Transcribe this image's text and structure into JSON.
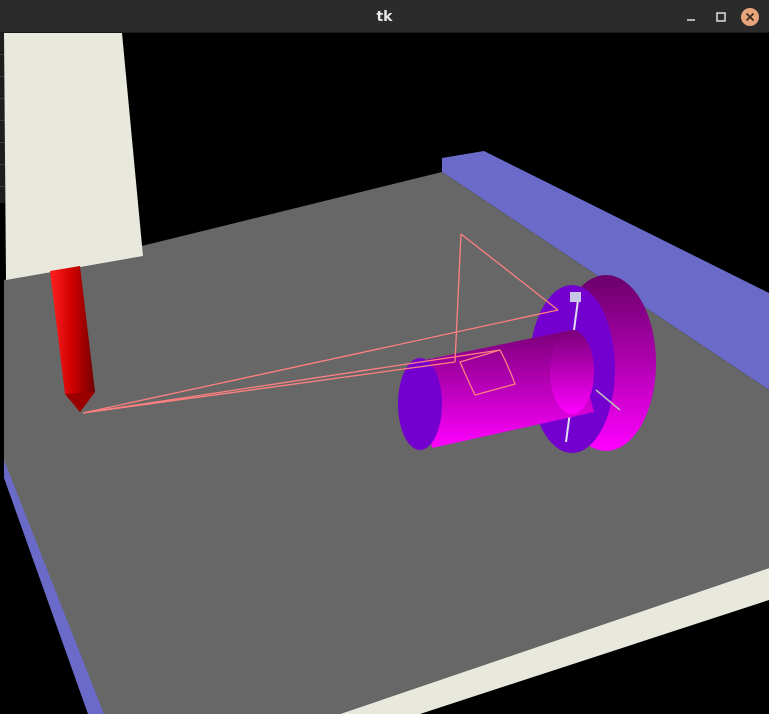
{
  "window": {
    "title": "tk"
  },
  "titlebar_buttons": {
    "minimize_icon": "minimize-icon",
    "maximize_icon": "maximize-icon",
    "close_icon": "close-icon"
  },
  "colors": {
    "background": "#000000",
    "table_top": "#676767",
    "table_edge_light": "#e8e8dc",
    "table_rail": "#6a6ac8",
    "spindle_block": "#e8e8dc",
    "tool": "#e00000",
    "workpiece": "#cc00cc",
    "workpiece_face": "#7a00cc",
    "toolpath": "#ff8080"
  }
}
